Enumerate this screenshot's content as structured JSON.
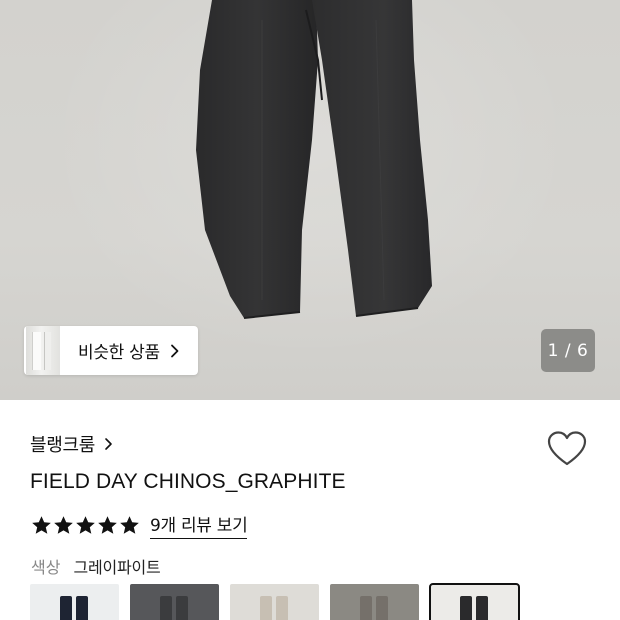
{
  "hero": {
    "similar_button_label": "비슷한 상품",
    "counter": "1 / 6",
    "image_index": 1,
    "image_count": 6
  },
  "product": {
    "brand": "블랭크룸",
    "title": "FIELD DAY CHINOS_GRAPHITE",
    "rating_stars": 5,
    "review_link": "9개 리뷰 보기",
    "color_label": "색상",
    "color_value": "그레이파이트"
  },
  "swatches": [
    {
      "name": "navy",
      "bg": "#eceeef",
      "pants": "#1e2433",
      "selected": false
    },
    {
      "name": "charcoal",
      "bg": "#56575a",
      "pants": "#3b3c3e",
      "selected": false
    },
    {
      "name": "beige",
      "bg": "#dedcd7",
      "pants": "#c7bfb3",
      "selected": false
    },
    {
      "name": "khaki-grey",
      "bg": "#8b8983",
      "pants": "#75706a",
      "selected": false
    },
    {
      "name": "graphite",
      "bg": "#ecebe8",
      "pants": "#2a2a2c",
      "selected": true
    }
  ],
  "colors": {
    "text": "#111111",
    "muted": "#888888",
    "star": "#111111",
    "counter_bg": "#78787680"
  }
}
